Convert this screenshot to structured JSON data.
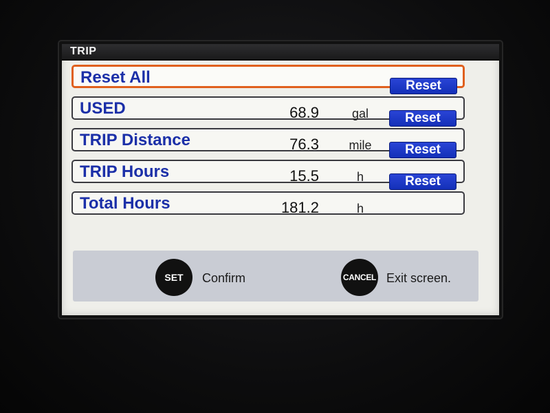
{
  "window": {
    "title": "TRIP"
  },
  "rows": [
    {
      "label": "Reset All",
      "value": "",
      "unit": "",
      "button": "Reset",
      "selected": true
    },
    {
      "label": "USED",
      "value": "68.9",
      "unit": "gal",
      "button": "Reset"
    },
    {
      "label": "TRIP Distance",
      "value": "76.3",
      "unit": "mile",
      "button": "Reset"
    },
    {
      "label": "TRIP Hours",
      "value": "15.5",
      "unit": "h",
      "button": "Reset"
    },
    {
      "label": "Total Hours",
      "value": "181.2",
      "unit": "h",
      "button": ""
    }
  ],
  "footer": {
    "set_button": "SET",
    "set_label": "Confirm",
    "cancel_button": "CANCEL",
    "cancel_label": "Exit screen."
  },
  "colors": {
    "label_blue": "#1b2fa8",
    "button_blue": "#1430b8",
    "selection_orange": "#e0601e",
    "screen_bg": "#efefea",
    "footer_bg": "#c9ccd4"
  }
}
